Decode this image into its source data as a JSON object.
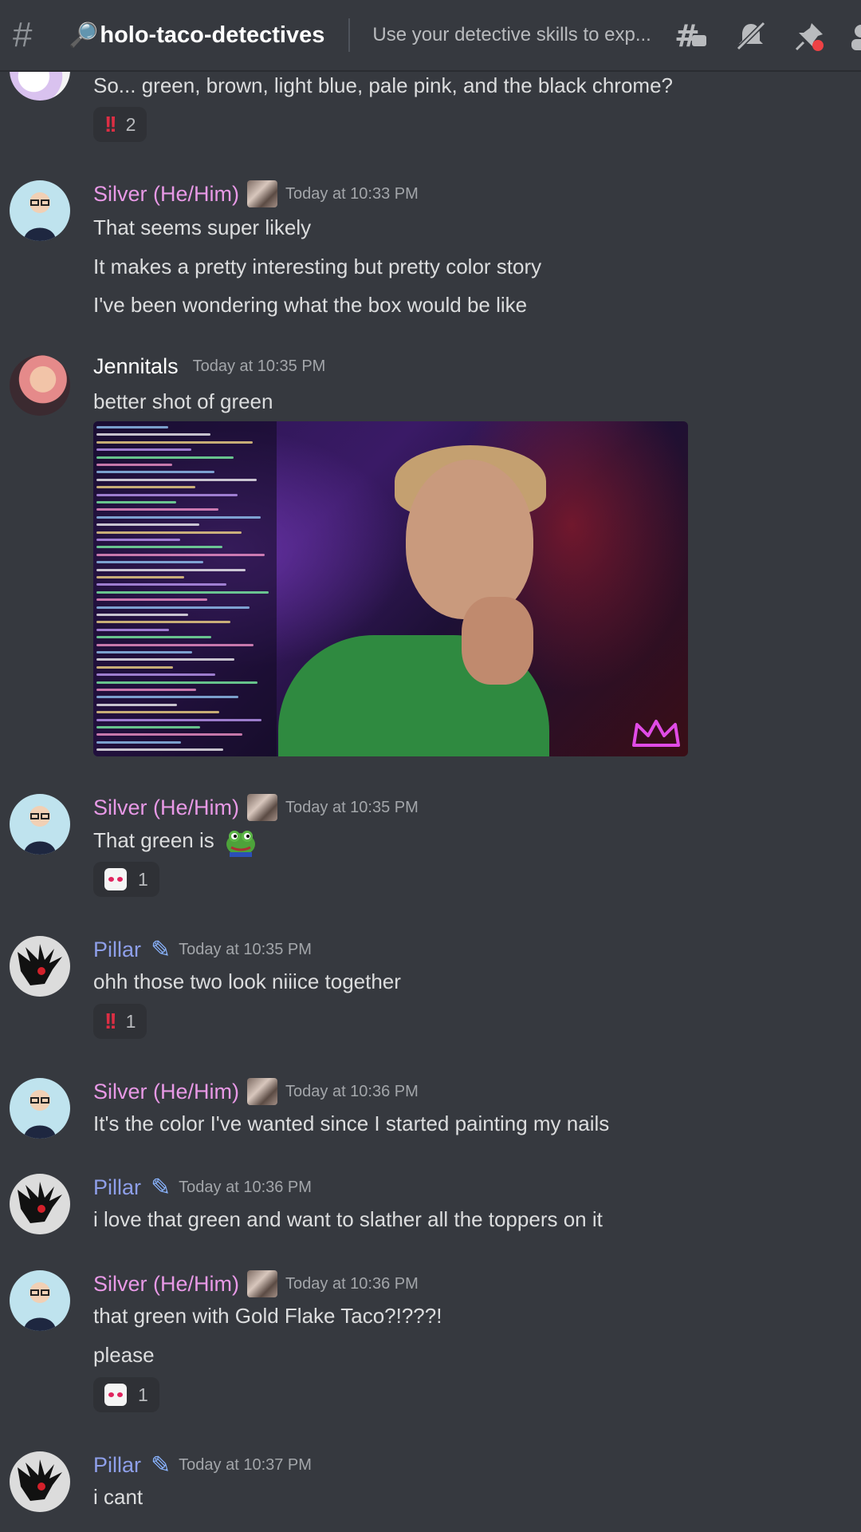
{
  "header": {
    "channel_emoji": "🔎",
    "channel_name": "holo-taco-detectives",
    "topic": "Use your detective skills to exp...",
    "icons": [
      "threads-icon",
      "mute-icon",
      "pin-icon",
      "members-icon"
    ]
  },
  "messages": [
    {
      "lines": [
        "So... green, brown, light blue, pale pink, and the black chrome?"
      ],
      "reaction": {
        "emoji": "double-exclamation",
        "count": "2"
      }
    },
    {
      "author": "Silver (He/Him)",
      "time": "Today at 10:33 PM",
      "lines": [
        "That seems super likely",
        "It makes a pretty interesting but pretty color story",
        "I've been wondering what the box would be like"
      ]
    },
    {
      "author": "Jennitals",
      "time": "Today at 10:35 PM",
      "lines": [
        "better shot of green"
      ]
    },
    {
      "author": "Silver (He/Him)",
      "time": "Today at 10:35 PM",
      "lines": [
        "That green is"
      ],
      "reaction": {
        "emoji": "heart-eyes-cat",
        "count": "1"
      }
    },
    {
      "author": "Pillar",
      "time": "Today at 10:35 PM",
      "lines": [
        "ohh those two look niiice together"
      ],
      "reaction": {
        "emoji": "double-exclamation",
        "count": "1"
      }
    },
    {
      "author": "Silver (He/Him)",
      "time": "Today at 10:36 PM",
      "lines": [
        "It's the color I've wanted since I started painting my nails"
      ]
    },
    {
      "author": "Pillar",
      "time": "Today at 10:36 PM",
      "lines": [
        "i love that green and want to slather all the toppers on it"
      ]
    },
    {
      "author": "Silver (He/Him)",
      "time": "Today at 10:36 PM",
      "lines": [
        "that green with Gold Flake Taco?!???!",
        "please"
      ],
      "reaction": {
        "emoji": "heart-eyes-cat",
        "count": "1"
      }
    },
    {
      "author": "Pillar",
      "time": "Today at 10:37 PM",
      "lines": [
        "i cant"
      ]
    }
  ],
  "colors": {
    "background": "#36393f",
    "silver_name": "#e899e6",
    "pillar_name": "#8e9fe9",
    "jennitals_name": "#ffffff",
    "timestamp": "#a3a6aa"
  }
}
